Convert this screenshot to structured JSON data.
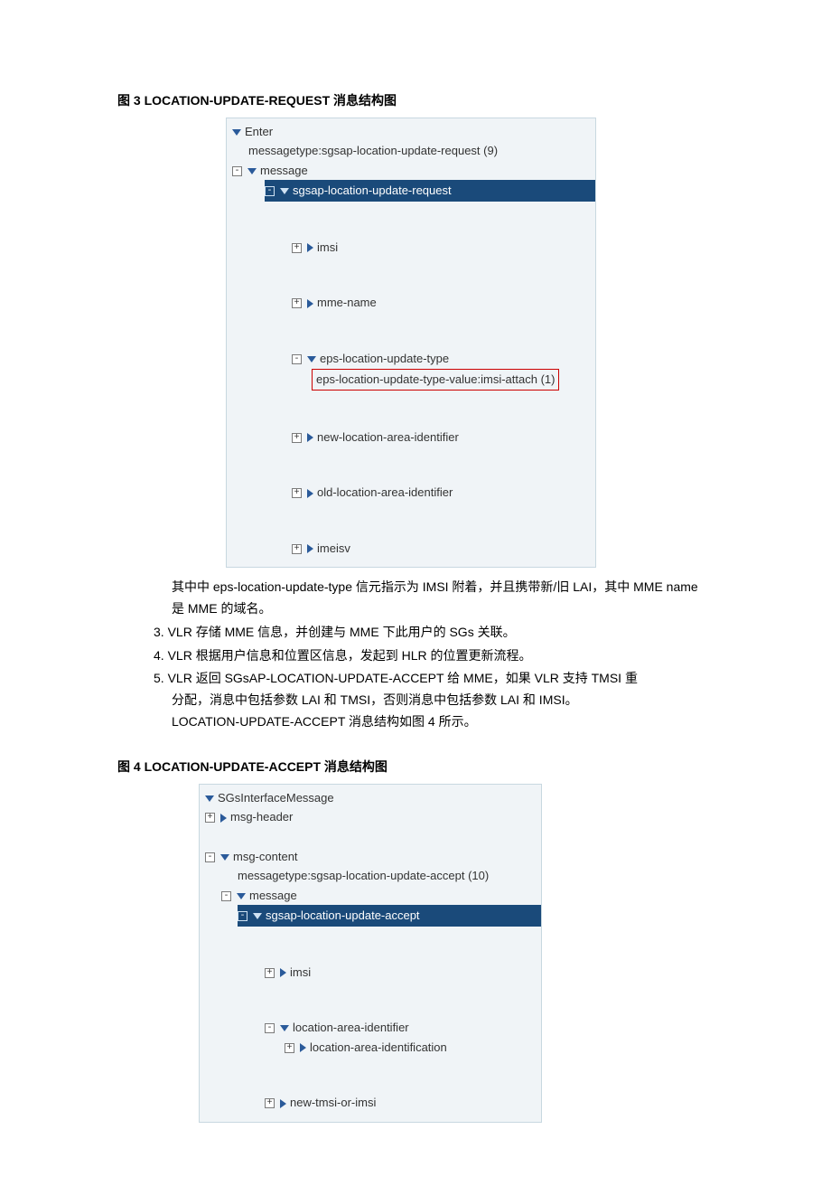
{
  "fig3": {
    "caption": "图 3 LOCATION-UPDATE-REQUEST 消息结构图",
    "tree": {
      "enter": "Enter",
      "messagetype": "messagetype:sgsap-location-update-request (9)",
      "message": "message",
      "selected": "sgsap-location-update-request",
      "imsi": "imsi",
      "mme_name": "mme-name",
      "eps_type": "eps-location-update-type",
      "eps_value": "eps-location-update-type-value:imsi-attach (1)",
      "new_lai": "new-location-area-identifier",
      "old_lai": "old-location-area-identifier",
      "imeisv": "imeisv"
    }
  },
  "para1": "其中中 eps-location-update-type 信元指示为 IMSI 附着，并且携带新/旧 LAI，其中 MME name 是 MME 的域名。",
  "item3": "3.  VLR 存储 MME 信息，并创建与 MME 下此用户的 SGs 关联。",
  "item4": "4.  VLR 根据用户信息和位置区信息，发起到 HLR 的位置更新流程。",
  "item5a": "5.  VLR 返回 SGsAP-LOCATION-UPDATE-ACCEPT 给 MME，如果 VLR 支持 TMSI 重",
  "item5b": "分配，消息中包括参数 LAI 和 TMSI，否则消息中包括参数 LAI 和 IMSI。",
  "item5c": "LOCATION-UPDATE-ACCEPT 消息结构如图 4 所示。",
  "fig4": {
    "caption": "图 4 LOCATION-UPDATE-ACCEPT 消息结构图",
    "tree": {
      "root": "SGsInterfaceMessage",
      "msg_header": "msg-header",
      "msg_content": "msg-content",
      "messagetype": "messagetype:sgsap-location-update-accept (10)",
      "message": "message",
      "selected": "sgsap-location-update-accept",
      "imsi": "imsi",
      "lai": "location-area-identifier",
      "lai_id": "location-area-identification",
      "new_tmsi": "new-tmsi-or-imsi"
    }
  }
}
